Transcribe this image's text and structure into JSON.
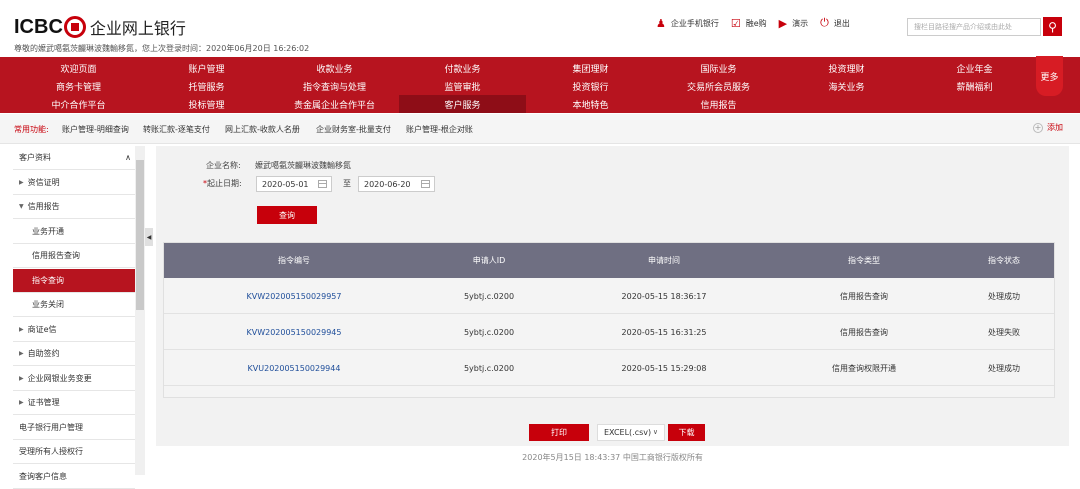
{
  "header": {
    "brand": "ICBC",
    "title": "企业网上银行",
    "welcome": "尊敬的嬤武噶氨茨麣琳波魏輸移氮，您上次登录时间：2020年06月20日 16:26:02",
    "top_links": [
      {
        "label": "企业手机银行",
        "icon": "person-icon"
      },
      {
        "label": "融e购",
        "icon": "cart-icon"
      },
      {
        "label": "演示",
        "icon": "play-icon"
      },
      {
        "label": "退出",
        "icon": "power-icon"
      }
    ],
    "search_placeholder": "搜栏目路径搜产品介绍或由此处"
  },
  "menu": {
    "rows": [
      [
        "欢迎页面",
        "账户管理",
        "收款业务",
        "付款业务",
        "集团理财",
        "国际业务",
        "投资理财",
        "企业年金"
      ],
      [
        "商务卡管理",
        "托管服务",
        "指令查询与处理",
        "监管审批",
        "投资银行",
        "交易所会员服务",
        "海关业务",
        "薪酬福利"
      ],
      [
        "中介合作平台",
        "投标管理",
        "贵金属企业合作平台",
        "客户服务",
        "本地特色",
        "信用报告",
        "",
        ""
      ]
    ],
    "active": "客户服务",
    "more": "更多"
  },
  "quick": {
    "label": "常用功能:",
    "items": [
      "账户管理-明细查询",
      "转账汇款-逐笔支付",
      "网上汇款-收款人名册",
      "企业财务室-批量支付",
      "账户管理-根企对账"
    ],
    "add": "添加"
  },
  "sidebar": {
    "items": [
      {
        "label": "客户资料",
        "type": "head"
      },
      {
        "label": "资信证明",
        "type": "group"
      },
      {
        "label": "信用报告",
        "type": "group-open"
      },
      {
        "label": "业务开通",
        "type": "sub"
      },
      {
        "label": "信用报告查询",
        "type": "sub"
      },
      {
        "label": "指令查询",
        "type": "sub-active"
      },
      {
        "label": "业务关闭",
        "type": "sub"
      },
      {
        "label": "商证e信",
        "type": "group"
      },
      {
        "label": "自助签约",
        "type": "group"
      },
      {
        "label": "企业网银业务变更",
        "type": "group"
      },
      {
        "label": "证书管理",
        "type": "group"
      },
      {
        "label": "电子银行用户管理",
        "type": "plain"
      },
      {
        "label": "受理所有人授权行",
        "type": "plain"
      },
      {
        "label": "查询客户信息",
        "type": "plain"
      }
    ]
  },
  "form": {
    "company_label": "企业名称:",
    "company_value": "嬤武噶氨茨麣琳波魏輸移氮",
    "date_label": "起止日期:",
    "date_from": "2020-05-01",
    "to": "至",
    "date_to": "2020-06-20",
    "query_button": "查询"
  },
  "table": {
    "headers": [
      "指令编号",
      "申请人ID",
      "申请时间",
      "指令类型",
      "指令状态"
    ],
    "rows": [
      [
        "KVW202005150029957",
        "5ybtj.c.0200",
        "2020-05-15 18:36:17",
        "信用报告查询",
        "处理成功"
      ],
      [
        "KVW202005150029945",
        "5ybtj.c.0200",
        "2020-05-15 16:31:25",
        "信用报告查询",
        "处理失败"
      ],
      [
        "KVU202005150029944",
        "5ybtj.c.0200",
        "2020-05-15 15:29:08",
        "信用查询权限开通",
        "处理成功"
      ]
    ]
  },
  "actions": {
    "print": "打印",
    "format": "EXCEL(.csv)",
    "download": "下载"
  },
  "footer": "2020年5月15日 18:43:37 中国工商银行版权所有",
  "colors": {
    "brand_red": "#c7000b",
    "menu_red": "#b7141f",
    "table_header": "#6f6f82",
    "link": "#1f4e9a"
  }
}
